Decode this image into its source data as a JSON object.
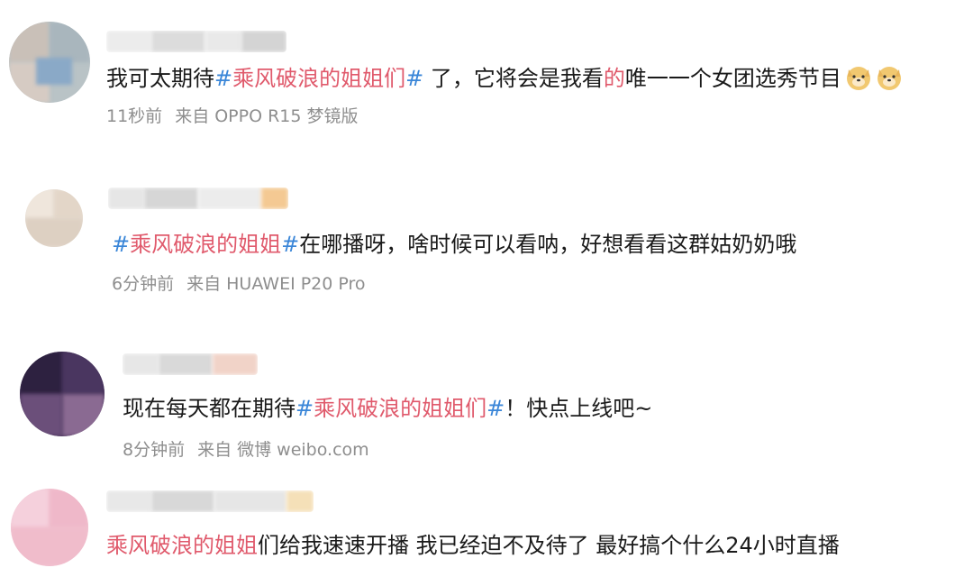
{
  "comments": [
    {
      "parts": {
        "p1": "我可太期待",
        "h1": "#",
        "tag": "乘风破浪的姐姐们",
        "h2": "#",
        "p2": " 了，它将会是我看",
        "red": "的",
        "p3": "唯一一个女团选秀节目"
      },
      "emojis": [
        "doge-emoji",
        "doge-emoji"
      ],
      "time": "11秒前",
      "source": "来自 OPPO R15 梦镜版"
    },
    {
      "parts": {
        "h1": "#",
        "tag": "乘风破浪的姐姐",
        "h2": "#",
        "p1": "在哪播呀，啥时候可以看呐，好想看看这群姑奶奶哦"
      },
      "time": "6分钟前",
      "source": "来自 HUAWEI P20 Pro"
    },
    {
      "parts": {
        "p1": "现在每天都在期待",
        "h1": "#",
        "tag": "乘风破浪的姐姐们",
        "h2": "#",
        "p2": "！快点上线吧~"
      },
      "time": "8分钟前",
      "source": "来自 微博 weibo.com"
    },
    {
      "parts": {
        "tag": "乘风破浪的姐姐",
        "p1": "们给我速速开播 我已经迫不及待了 最好搞个什么24小时直播"
      }
    }
  ],
  "colors": {
    "topic": "#e05a6c",
    "hash": "#3a86d8",
    "meta": "#8e8e8e"
  }
}
